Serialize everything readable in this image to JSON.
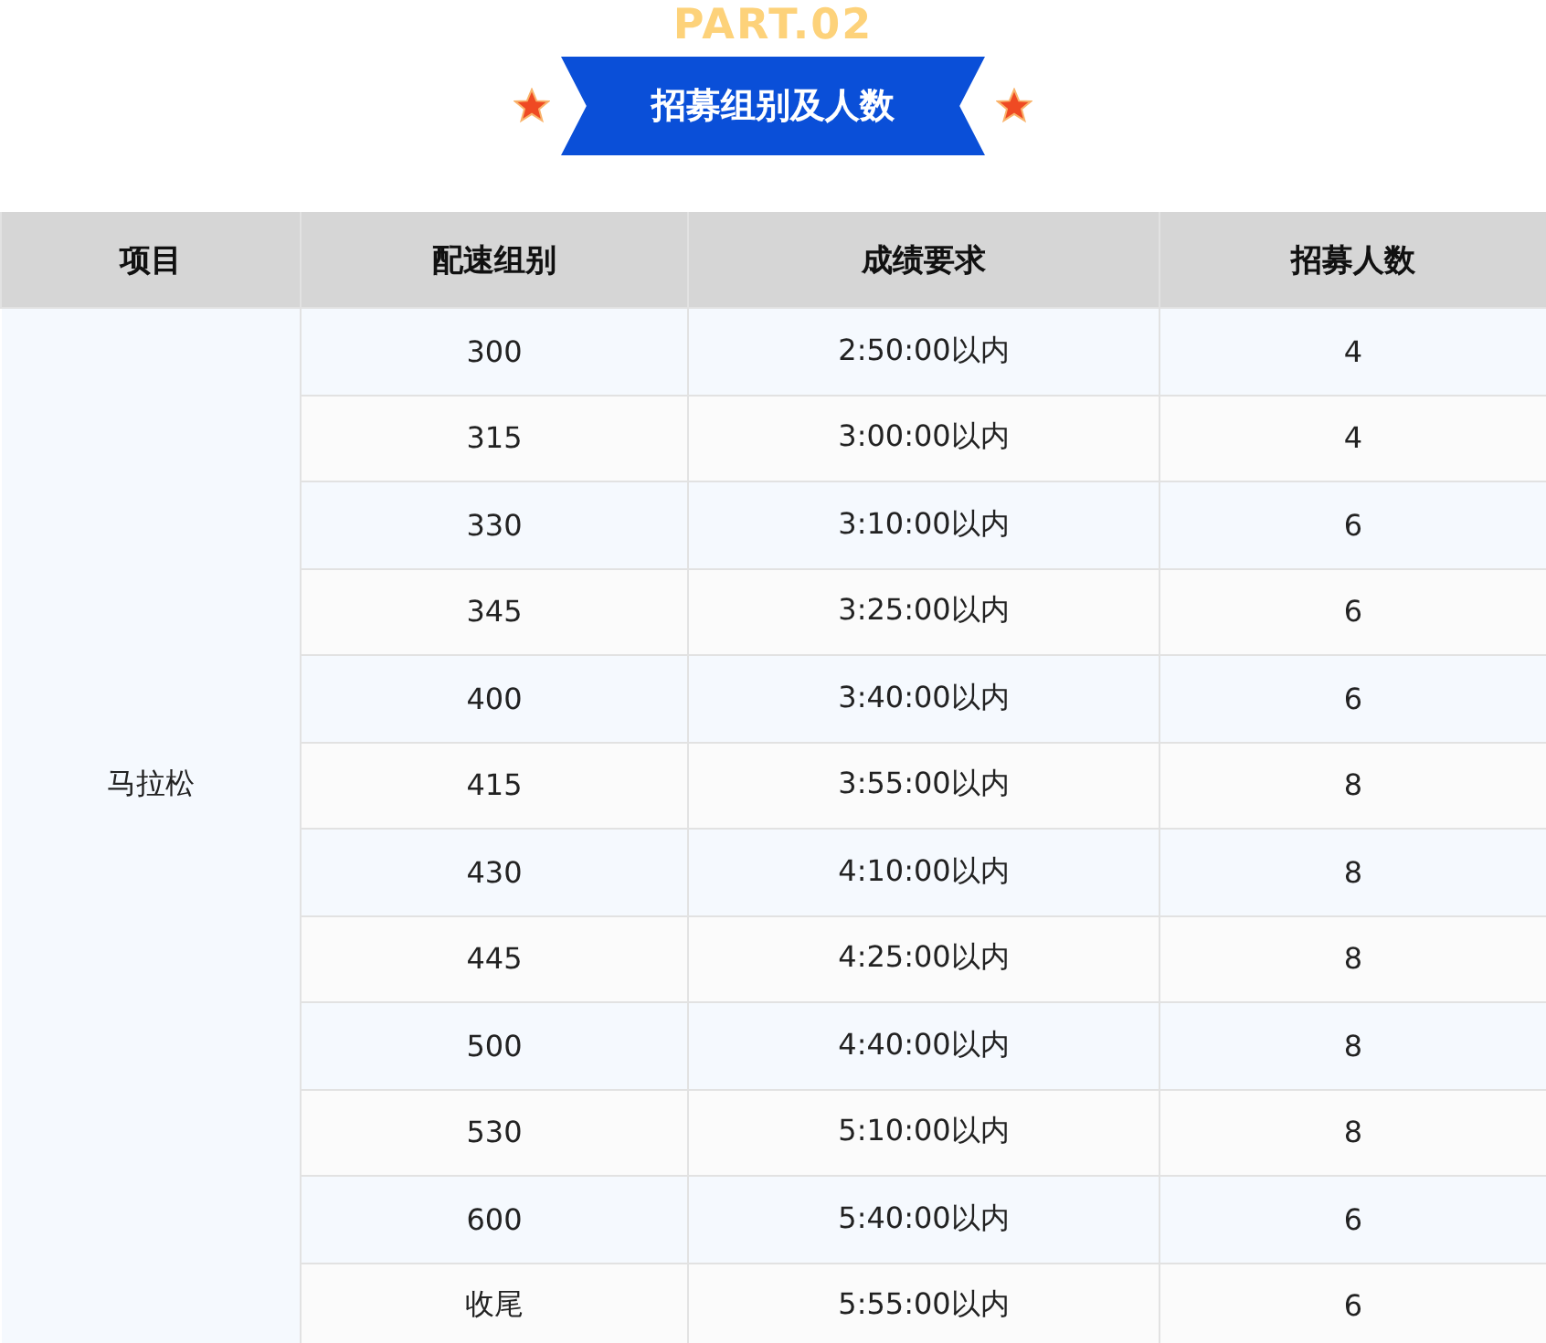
{
  "part_label": "PART.02",
  "section_title": "招募组别及人数",
  "table": {
    "columns": [
      "项目",
      "配速组别",
      "成绩要求",
      "招募人数"
    ],
    "rows": [
      [
        "",
        "300",
        "2:50:00以内",
        "4"
      ],
      [
        "",
        "315",
        "3:00:00以内",
        "4"
      ],
      [
        "",
        "330",
        "3:10:00以内",
        "6"
      ],
      [
        "",
        "345",
        "3:25:00以内",
        "6"
      ],
      [
        "",
        "400",
        "3:40:00以内",
        "6"
      ],
      [
        "马拉松",
        "415",
        "3:55:00以内",
        "8"
      ],
      [
        "",
        "430",
        "4:10:00以内",
        "8"
      ],
      [
        "",
        "445",
        "4:25:00以内",
        "8"
      ],
      [
        "",
        "500",
        "4:40:00以内",
        "8"
      ],
      [
        "",
        "530",
        "5:10:00以内",
        "8"
      ],
      [
        "",
        "600",
        "5:40:00以内",
        "6"
      ],
      [
        "",
        "收尾",
        "5:55:00以内",
        "6"
      ]
    ]
  }
}
